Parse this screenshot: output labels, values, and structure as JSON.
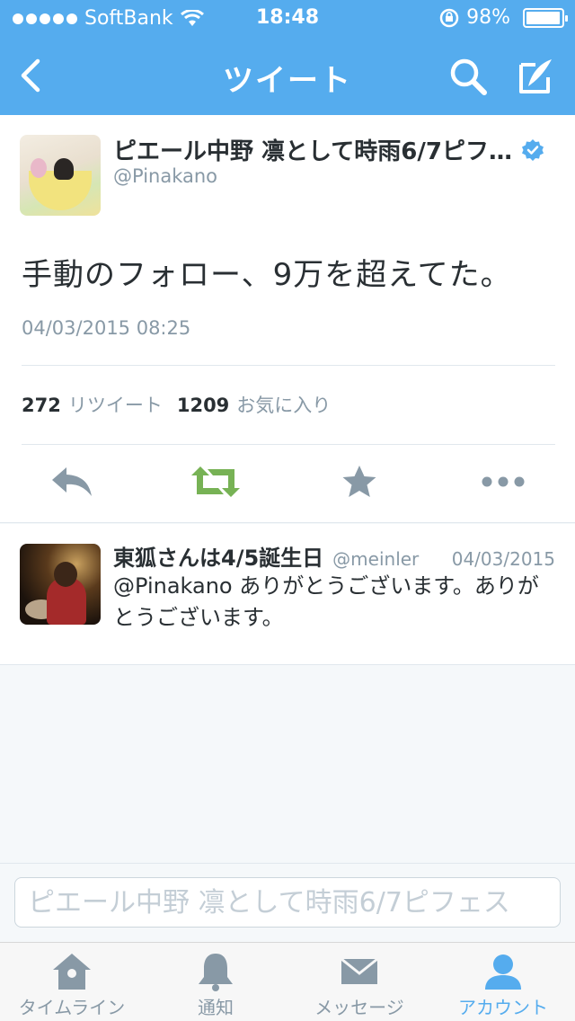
{
  "status_bar": {
    "carrier": "SoftBank",
    "time": "18:48",
    "battery": "98%",
    "battery_level": 0.98
  },
  "nav": {
    "title": "ツイート",
    "icons": [
      "back-icon",
      "search-icon",
      "compose-icon"
    ]
  },
  "tweet": {
    "author_name": "ピエール中野 凛として時雨6/7ピフ…",
    "handle": "@Pinakano",
    "verified": true,
    "text": "手動のフォロー、9万を超えてた。",
    "timestamp": "04/03/2015 08:25",
    "retweet_count": "272",
    "retweet_label": "リツイート",
    "favorite_count": "1209",
    "favorite_label": "お気に入り",
    "actions": [
      "reply-icon",
      "retweet-icon",
      "favorite-icon",
      "more-icon"
    ]
  },
  "reply": {
    "author_name": "東狐さんは4/5誕生日",
    "handle": "@meinler",
    "date": "04/03/2015",
    "text": "@Pinakano ありがとうございます。ありがとうございます。"
  },
  "reply_box": {
    "placeholder": "ピエール中野 凛として時雨6/7ピフェス"
  },
  "tabs": [
    {
      "label": "タイムライン",
      "icon": "home-icon",
      "active": false
    },
    {
      "label": "通知",
      "icon": "bell-icon",
      "active": false
    },
    {
      "label": "メッセージ",
      "icon": "envelope-icon",
      "active": false
    },
    {
      "label": "アカウント",
      "icon": "person-icon",
      "active": true
    }
  ],
  "colors": {
    "brand": "#55acee",
    "retweet_green": "#77b255",
    "icon_gray": "#8899a6"
  }
}
